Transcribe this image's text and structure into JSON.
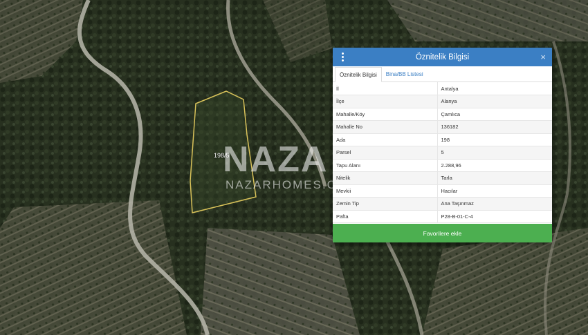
{
  "map": {
    "parcel_label": "198/5",
    "watermark_main": "NAZA",
    "watermark_sub": "NAZARHOMES.C"
  },
  "panel": {
    "title": "Öznitelik Bilgisi",
    "menu_icon": "vertical-dots-icon",
    "close_icon": "close-icon",
    "close_glyph": "×",
    "tabs": [
      {
        "label": "Öznitelik Bilgisi",
        "active": true
      },
      {
        "label": "Bina/BB Listesi",
        "active": false
      }
    ],
    "rows": [
      {
        "key": "İl",
        "value": "Antalya"
      },
      {
        "key": "İlçe",
        "value": "Alanya"
      },
      {
        "key": "Mahalle/Köy",
        "value": "Çamlıca"
      },
      {
        "key": "Mahalle No",
        "value": "136182"
      },
      {
        "key": "Ada",
        "value": "198"
      },
      {
        "key": "Parsel",
        "value": "5"
      },
      {
        "key": "Tapu Alanı",
        "value": "2.288,96"
      },
      {
        "key": "Nitelik",
        "value": "Tarla"
      },
      {
        "key": "Mevkii",
        "value": "Hacılar"
      },
      {
        "key": "Zemin Tip",
        "value": "Ana Taşınmaz"
      },
      {
        "key": "Pafta",
        "value": "P28-B-01-C-4"
      }
    ],
    "favorite_button": "Favorilere ekle"
  },
  "colors": {
    "header_blue": "#3b7fc4",
    "button_green": "#4caf50",
    "parcel_outline": "#d8c25a"
  }
}
